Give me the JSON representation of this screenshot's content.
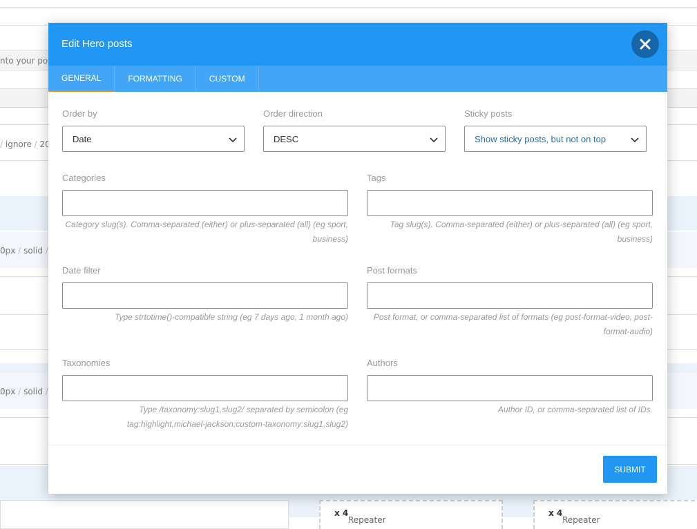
{
  "background": {
    "field_text": "nto your pos",
    "breadcrumb": [
      "ignore",
      "20"
    ],
    "border_row_1": [
      "0px",
      "solid"
    ],
    "border_row_2": [
      "0px",
      "solid"
    ],
    "repeaters": [
      {
        "label": "Repeater",
        "count": "x 4"
      },
      {
        "label": "Repeater",
        "count": "x 4"
      }
    ]
  },
  "modal": {
    "title": "Edit Hero posts",
    "close_icon": "close-icon",
    "tabs": [
      {
        "label": "GENERAL",
        "active": true
      },
      {
        "label": "FORMATTING",
        "active": false
      },
      {
        "label": "CUSTOM",
        "active": false
      }
    ],
    "fields": {
      "order_by": {
        "label": "Order by",
        "value": "Date"
      },
      "order_direction": {
        "label": "Order direction",
        "value": "DESC"
      },
      "sticky_posts": {
        "label": "Sticky posts",
        "value": "Show sticky posts, but not on top"
      },
      "categories": {
        "label": "Categories",
        "value": "",
        "hint": "Category slug(s). Comma-separated (either) or plus-separated (all) (eg sport, business)"
      },
      "tags": {
        "label": "Tags",
        "value": "",
        "hint": "Tag slug(s). Comma-separated (either) or plus-separated (all) (eg sport, business)"
      },
      "date_filter": {
        "label": "Date filter",
        "value": "",
        "hint": "Type strtotime()-compatible string (eg 7 days ago, 1 month ago)"
      },
      "post_formats": {
        "label": "Post formats",
        "value": "",
        "hint": "Post format, or comma-separated list of formats (eg post-format-video, post-format-audio)"
      },
      "taxonomies": {
        "label": "Taxonomies",
        "value": "",
        "hint": "Type /taxonomy:slug1,slug2/ separated by semicolon (eg tag:highlight,michael-jackson;custom-taxonomy:slug1,slug2)"
      },
      "authors": {
        "label": "Authors",
        "value": "",
        "hint": "Author ID, or comma-separated list of IDs."
      }
    },
    "submit_label": "SUBMIT"
  },
  "colors": {
    "header": "#2196f3",
    "tabs": "#42a5f5",
    "close_button": "#1565a8",
    "active_tab_underline": "#f08a24",
    "submit": "#2196f3"
  }
}
